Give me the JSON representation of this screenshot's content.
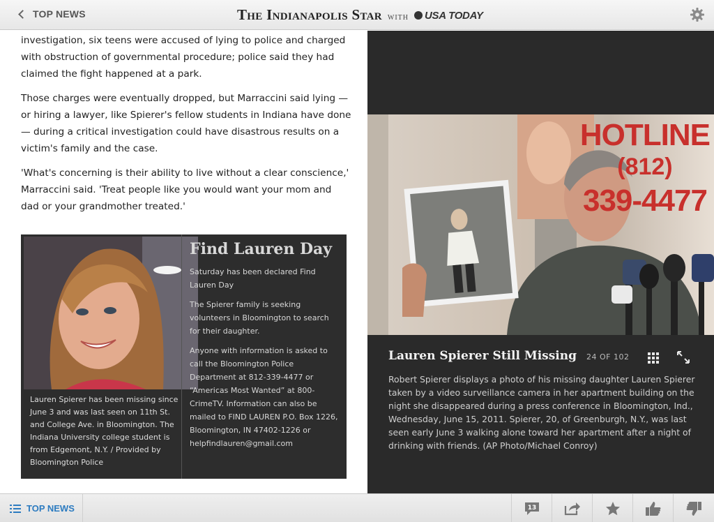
{
  "header": {
    "back_label": "TOP NEWS",
    "paper_name": "The Indianapolis Star",
    "with_label": "WITH",
    "partner_name": "USA TODAY"
  },
  "article": {
    "paragraphs": [
      "investigation, six teens were accused of lying to police and charged with obstruction of governmental procedure; police said they had claimed the fight happened at a park.",
      "Those charges were eventually dropped, but Marraccini said lying — or hiring a lawyer, like Spierer's fellow students in Indiana have done — during a critical investigation could have disastrous results on a victim's family and the case.",
      "'What's concerning is their ability to live without a clear conscience,' Marraccini said. 'Treat people like you would want your mom and dad or your grandmother treated.'"
    ]
  },
  "infobox": {
    "title": "Find Lauren Day",
    "photo_caption": "Lauren Spierer has been missing since June 3 and was last seen on 11th St. and College Ave. in Bloomington. The Indiana University college student is from Edgemont, N.Y. / Provided by Bloomington Police",
    "paragraphs": [
      "Saturday has been declared Find Lauren Day",
      "The Spierer family is seeking volunteers in Bloomington to search for their daughter.",
      "Anyone with information is asked to call the Bloomington Police Department at 812-339-4477 or “Americas Most Wanted” at 800-CrimeTV. Information can also be mailed to FIND LAUREN P.O. Box 1226, Bloomington, IN 47402-1226 or helpfindlauren@gmail.com"
    ]
  },
  "gallery": {
    "sign_lines": [
      "HOTLINE",
      "(812)",
      "339-4477"
    ],
    "title": "Lauren Spierer Still Missing",
    "counter": "24 OF 102",
    "caption": "Robert Spierer displays a photo of his missing daughter Lauren Spierer taken by a video surveillance camera in her apartment building on the night she disappeared during a press conference in Bloomington, Ind., Wednesday, June 15, 2011. Spierer, 20, of Greenburgh, N.Y., was last seen early June 3 walking alone toward her apartment after a night of drinking with friends. (AP Photo/Michael Conroy)"
  },
  "bottombar": {
    "topnews_label": "TOP NEWS",
    "comment_count": "13"
  },
  "colors": {
    "accent": "#2c7bc0",
    "panel": "#2a2a2a",
    "sign_red": "#c8302c"
  }
}
